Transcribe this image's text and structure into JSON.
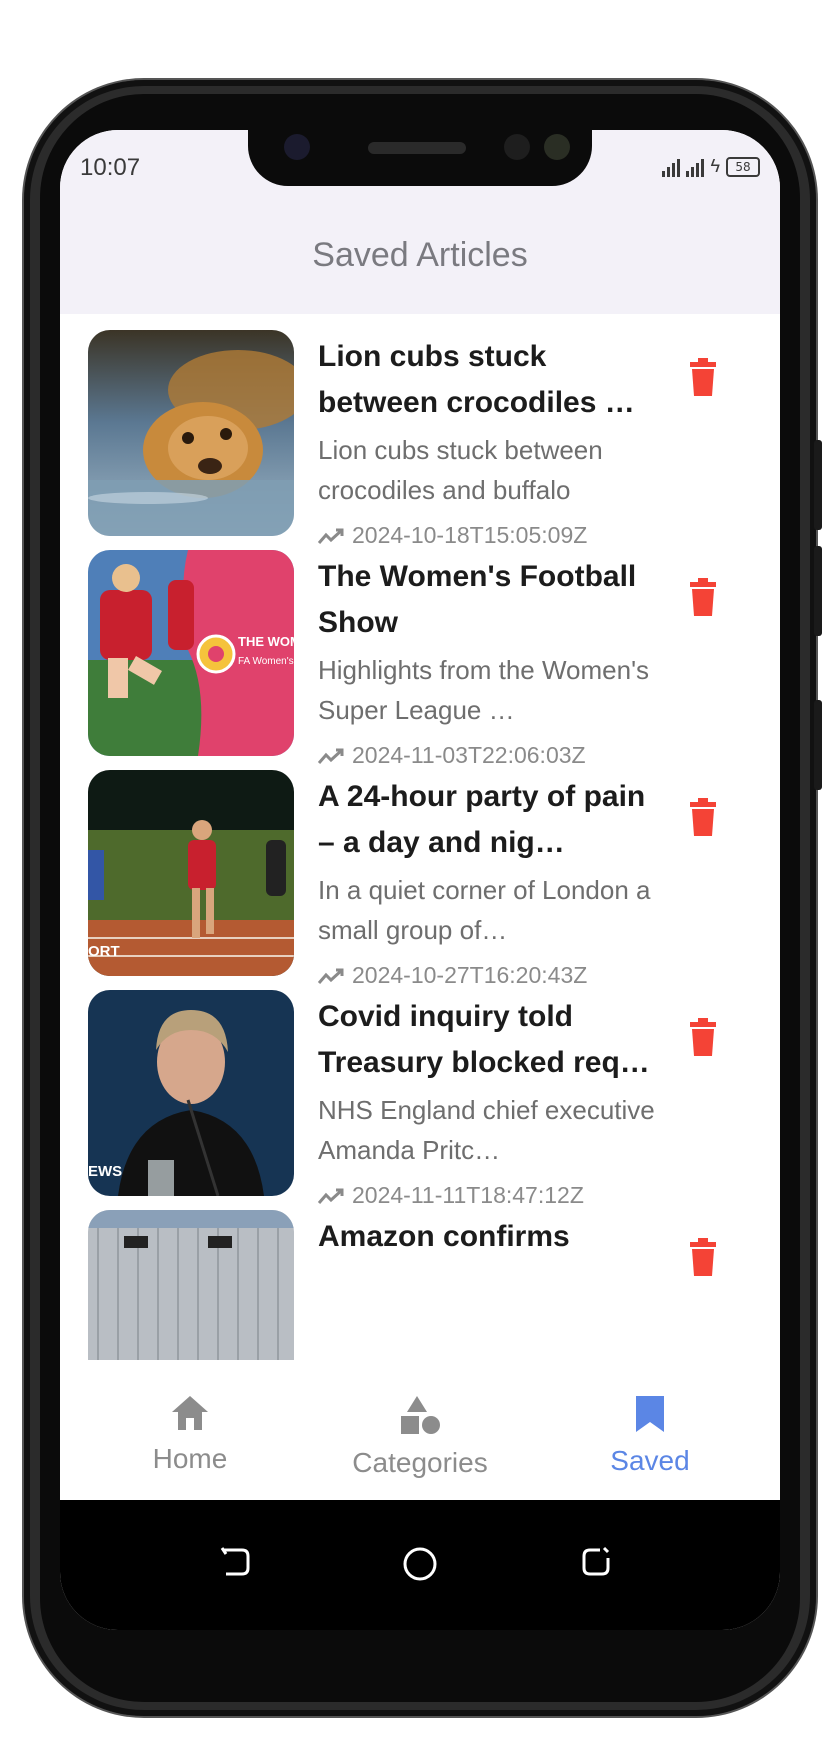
{
  "status_bar": {
    "time": "10:07",
    "battery": "58"
  },
  "header": {
    "title": "Saved Articles"
  },
  "articles": [
    {
      "title": "Lion cubs stuck between crocodiles …",
      "description": "Lion cubs stuck between crocodiles and buffalo",
      "date": "2024-10-18T15:05:09Z"
    },
    {
      "title": "The Women's Football Show",
      "description": "Highlights from the Women's Super League …",
      "date": "2024-11-03T22:06:03Z",
      "thumb_text": "THE WOMEN'S FOOTBALL",
      "thumb_sub": "FA Women's"
    },
    {
      "title": "A 24-hour party of pain – a day and nig…",
      "description": "In a quiet corner of London a small group of…",
      "date": "2024-10-27T16:20:43Z",
      "thumb_text": "ORT"
    },
    {
      "title": "Covid inquiry told Treasury blocked req…",
      "description": "NHS England chief executive Amanda Pritc…",
      "date": "2024-11-11T18:47:12Z",
      "thumb_text": "EWS"
    },
    {
      "title": "Amazon confirms",
      "description": "",
      "date": ""
    }
  ],
  "nav": {
    "home": "Home",
    "categories": "Categories",
    "saved": "Saved"
  },
  "colors": {
    "accent": "#5b86e5",
    "delete": "#f44336",
    "appbar": "#f3f1f8"
  }
}
